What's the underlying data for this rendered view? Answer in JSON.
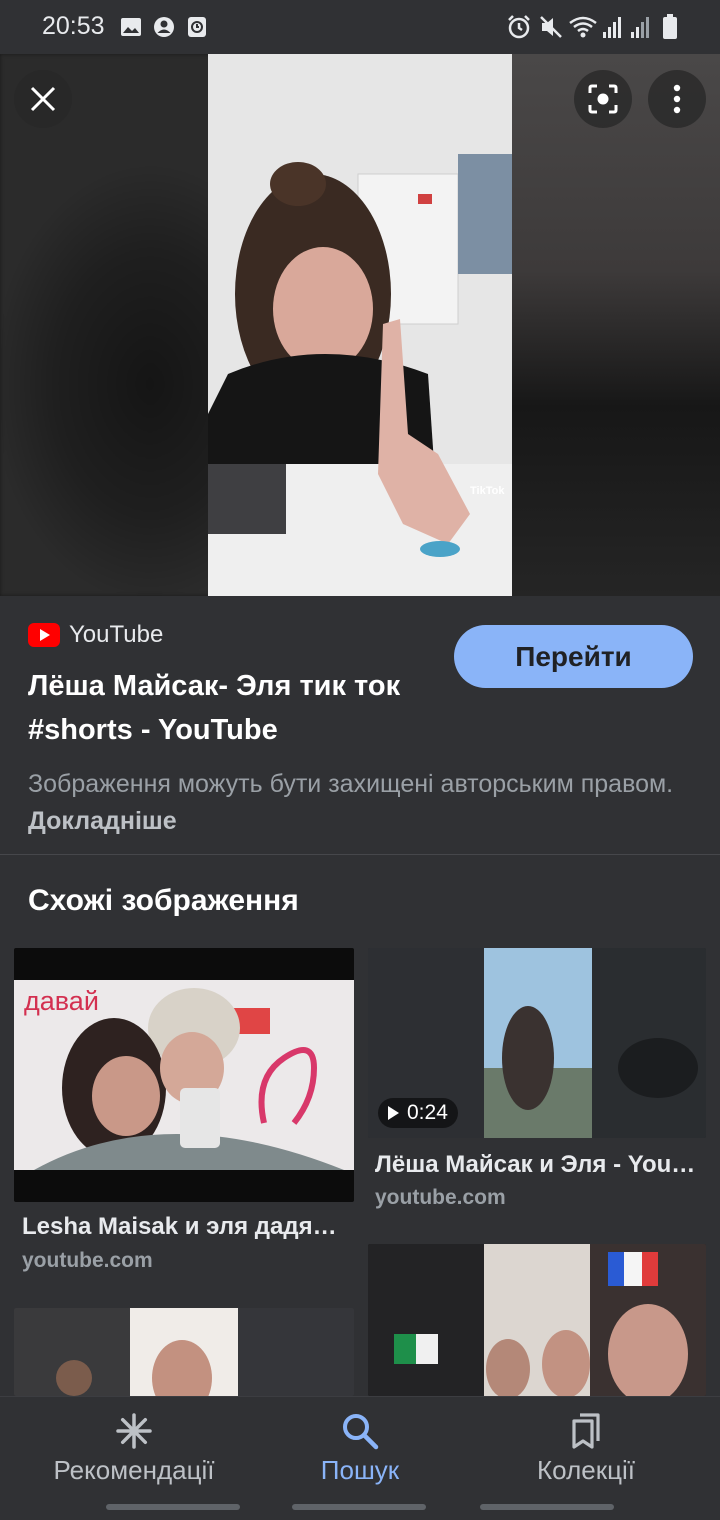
{
  "status_bar": {
    "time": "20:53",
    "left_icons": [
      "image-icon",
      "account-icon",
      "screen-record-icon"
    ],
    "right_icons": [
      "alarm-icon",
      "mute-icon",
      "wifi-icon",
      "signal-icon",
      "signal-icon",
      "battery-icon"
    ]
  },
  "viewer": {
    "close_icon": "close-icon",
    "lens_icon": "google-lens-icon",
    "menu_icon": "more-vert-icon",
    "watermark": "TikTok"
  },
  "result": {
    "source_name": "YouTube",
    "visit_label": "Перейти",
    "title": "Лёша Майсак- Эля тик ток #shorts - YouTube",
    "copyright_text": "Зображення можуть бути захищені авторським правом.",
    "learn_more": "Докладніше"
  },
  "related": {
    "heading": "Схожі зображення",
    "items": [
      {
        "thumb_text": "давай",
        "title": "Lesha Maisak и эля дадя…",
        "source": "youtube.com"
      },
      {
        "duration": "0:24",
        "title": "Лёша Майсак и Эля - You…",
        "source": "youtube.com"
      },
      {
        "title": "",
        "source": ""
      },
      {
        "title": "",
        "source": ""
      }
    ]
  },
  "bottom_nav": {
    "items": [
      {
        "label": "Рекомендації",
        "icon": "asterisk-icon",
        "active": false
      },
      {
        "label": "Пошук",
        "icon": "search-icon",
        "active": true
      },
      {
        "label": "Колекції",
        "icon": "collections-icon",
        "active": false
      }
    ]
  },
  "colors": {
    "background": "#303134",
    "accent": "#8ab4f8",
    "youtube_red": "#ff0000"
  }
}
